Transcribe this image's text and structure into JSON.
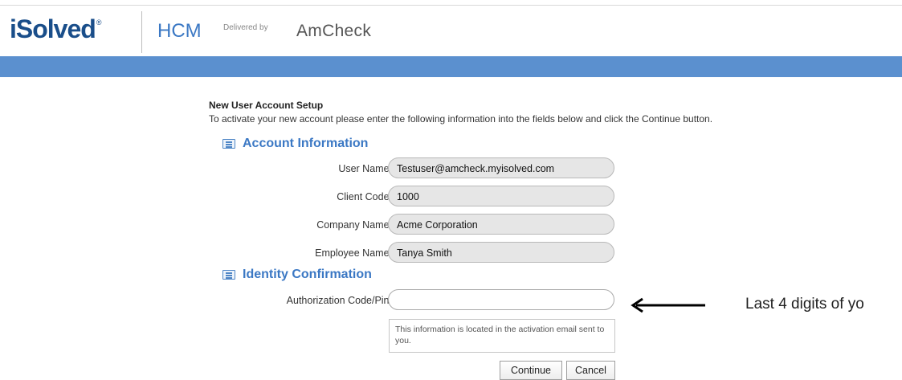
{
  "header": {
    "brand_isolved": "iSolved",
    "brand_hcm": "HCM",
    "delivered_by": "Delivered by",
    "partner": "AmCheck",
    "colors": {
      "brand_blue": "#1a4e8a",
      "accent_blue": "#3b78c4",
      "band": "#5b90cf"
    }
  },
  "page": {
    "title": "New User Account Setup",
    "instructions": "To activate your new account please enter the following information into the fields below and click the Continue button."
  },
  "account_section": {
    "title": "Account Information",
    "icon": "list-icon",
    "fields": [
      {
        "label": "User Name:",
        "value": "Testuser@amcheck.myisolved.com"
      },
      {
        "label": "Client Code:",
        "value": "1000"
      },
      {
        "label": "Company Name:",
        "value": "Acme Corporation"
      },
      {
        "label": "Employee Name:",
        "value": "Tanya Smith"
      }
    ]
  },
  "identity_section": {
    "title": "Identity Confirmation",
    "icon": "list-icon",
    "auth_label": "Authorization Code/Pin:",
    "auth_value": "",
    "hint": "This information is located in the activation email sent to you."
  },
  "annotation": {
    "arrow_icon": "left-arrow-icon",
    "note": "Last 4 digits of yo"
  },
  "buttons": {
    "continue": "Continue",
    "cancel": "Cancel"
  }
}
